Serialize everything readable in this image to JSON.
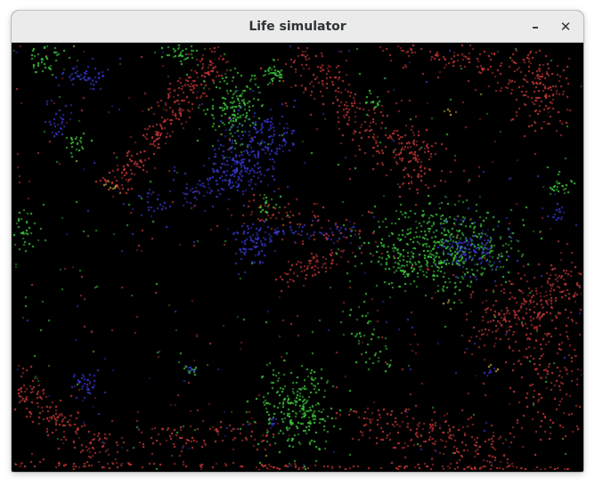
{
  "window": {
    "title": "Life simulator",
    "minimize_glyph": "–",
    "close_glyph": "✕"
  },
  "simulation": {
    "background_color": "#000000",
    "particle_colors": {
      "red": "#d23a3a",
      "green": "#3fd23f",
      "blue": "#3a3ad8",
      "yellow": "#d2b43a"
    }
  }
}
